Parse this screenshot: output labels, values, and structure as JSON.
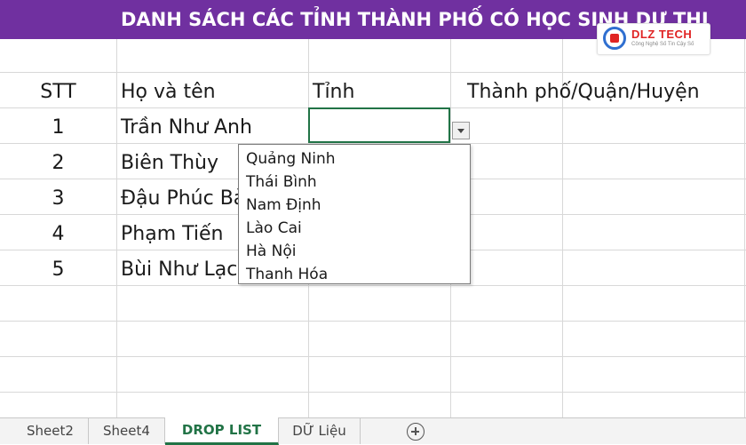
{
  "banner": {
    "title": "DANH SÁCH CÁC TỈNH THÀNH PHỐ CÓ HỌC SINH DỰ THI"
  },
  "logo": {
    "brand": "DLZ TECH",
    "tagline": "Công Nghệ Số Tin Cậy Số"
  },
  "sheet": {
    "headers": {
      "stt": "STT",
      "name": "Họ và tên",
      "province": "Tỉnh",
      "city": "Thành phố/Quận/Huyện"
    },
    "rows": [
      {
        "stt": "1",
        "name": "Trần Như Anh"
      },
      {
        "stt": "2",
        "name": "Biên Thùy"
      },
      {
        "stt": "3",
        "name": "Đậu Phúc Bảo"
      },
      {
        "stt": "4",
        "name": "Phạm Tiến"
      },
      {
        "stt": "5",
        "name": "Bùi Như Lạc"
      }
    ]
  },
  "dropdown": {
    "options": [
      "Quảng Ninh",
      "Thái Bình",
      "Nam Định",
      "Lào Cai",
      "Hà Nội",
      "Thanh Hóa"
    ]
  },
  "tabs": [
    {
      "label": "Sheet2",
      "active": false
    },
    {
      "label": "Sheet4",
      "active": false
    },
    {
      "label": "DROP LIST",
      "active": true
    },
    {
      "label": "DỮ Liệu",
      "active": false
    }
  ],
  "colors": {
    "banner": "#7030a0",
    "accent": "#217346",
    "logo_red": "#e02424",
    "logo_blue": "#2f6fd0"
  }
}
